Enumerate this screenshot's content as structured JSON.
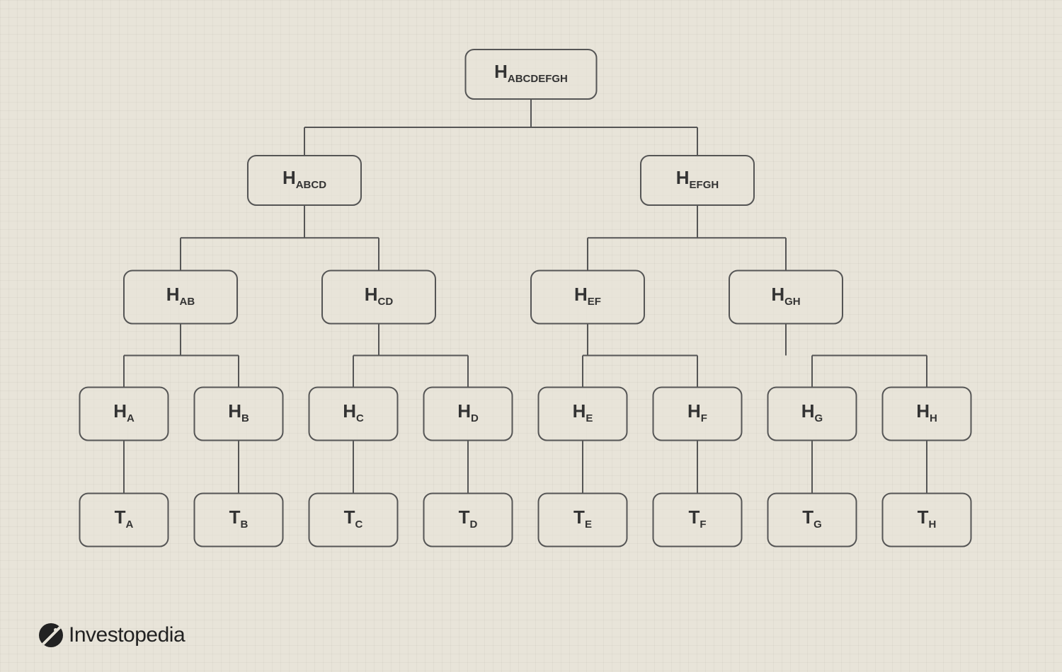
{
  "brand": {
    "name": "Investopedia"
  },
  "diagram": {
    "type": "merkle-tree",
    "node_prefix_hash": "H",
    "node_prefix_tx": "T",
    "levels": [
      {
        "role": "root",
        "prefix": "H",
        "items": [
          "ABCDEFGH"
        ]
      },
      {
        "role": "hash",
        "prefix": "H",
        "items": [
          "ABCD",
          "EFGH"
        ]
      },
      {
        "role": "hash",
        "prefix": "H",
        "items": [
          "AB",
          "CD",
          "EF",
          "GH"
        ]
      },
      {
        "role": "hash",
        "prefix": "H",
        "items": [
          "A",
          "B",
          "C",
          "D",
          "E",
          "F",
          "G",
          "H"
        ]
      },
      {
        "role": "transaction",
        "prefix": "T",
        "items": [
          "A",
          "B",
          "C",
          "D",
          "E",
          "F",
          "G",
          "H"
        ]
      }
    ]
  },
  "colors": {
    "background": "#e8e4d9",
    "stroke": "#555555",
    "text": "#333333"
  }
}
